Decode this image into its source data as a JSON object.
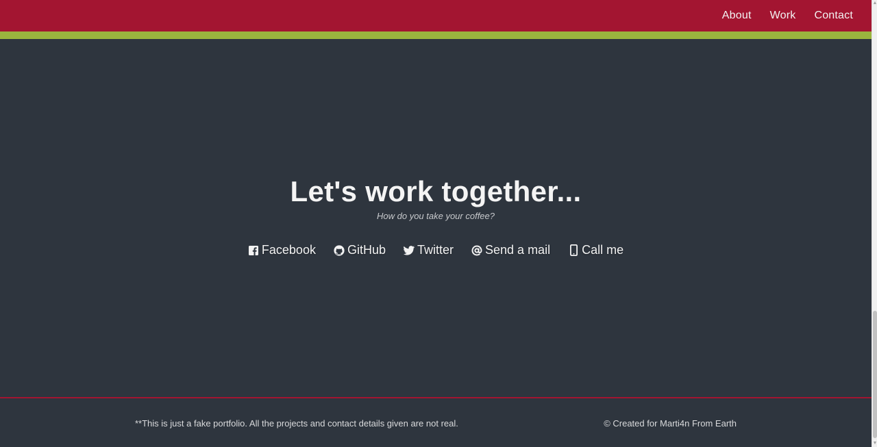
{
  "nav": {
    "items": [
      {
        "label": "About"
      },
      {
        "label": "Work"
      },
      {
        "label": "Contact"
      }
    ]
  },
  "contact": {
    "title": "Let's work together...",
    "subtitle": "How do you take your coffee?",
    "links": [
      {
        "label": "Facebook",
        "icon": "facebook-square-icon"
      },
      {
        "label": "GitHub",
        "icon": "github-icon"
      },
      {
        "label": "Twitter",
        "icon": "twitter-icon"
      },
      {
        "label": "Send a mail",
        "icon": "at-sign-icon"
      },
      {
        "label": "Call me",
        "icon": "mobile-phone-icon"
      }
    ]
  },
  "footer": {
    "note": "**This is just a fake portfolio. All the projects and contact details given are not real.",
    "credit": "© Created for Marti4n From Earth"
  },
  "colors": {
    "navbar": "#a31531",
    "accent_stripe": "#9ab53e",
    "background": "#2e353e",
    "text": "#f4f4f4"
  }
}
